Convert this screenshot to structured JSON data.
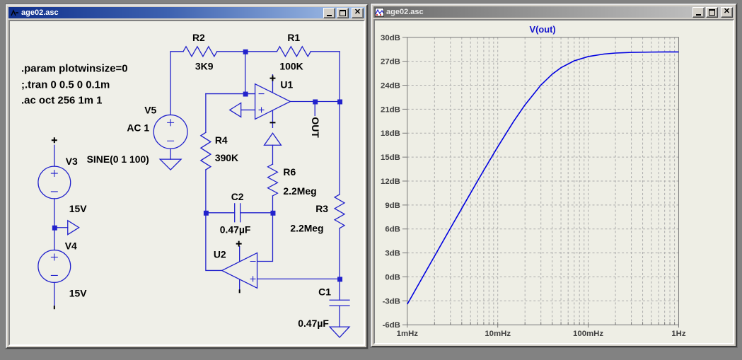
{
  "left_window": {
    "title": "age02.asc"
  },
  "right_window": {
    "title": "age02.asc"
  },
  "schematic": {
    "directives": [
      ".param plotwinsize=0",
      ";.tran 0 0.5 0 0.1m",
      ".ac oct 256 1m 1"
    ],
    "components": {
      "R1": {
        "name": "R1",
        "value": "100K"
      },
      "R2": {
        "name": "R2",
        "value": "3K9"
      },
      "R3": {
        "name": "R3",
        "value": "2.2Meg"
      },
      "R4": {
        "name": "R4",
        "value": "390K"
      },
      "R6": {
        "name": "R6",
        "value": "2.2Meg"
      },
      "C1": {
        "name": "C1",
        "value": "0.47µF"
      },
      "C2": {
        "name": "C2",
        "value": "0.47µF"
      },
      "U1": {
        "name": "U1"
      },
      "U2": {
        "name": "U2"
      },
      "V3": {
        "name": "V3",
        "value": "15V"
      },
      "V4": {
        "name": "V4",
        "value": "15V"
      },
      "V5": {
        "name": "V5",
        "value": "AC 1",
        "value2": "SINE(0 1 100)"
      }
    },
    "net_labels": {
      "out": "OUT"
    }
  },
  "chart_data": {
    "type": "line",
    "title": "V(out)",
    "x_scale": "log",
    "x_unit": "Hz",
    "y_unit": "dB",
    "x_range_hz": [
      0.001,
      1
    ],
    "y_range_db": [
      -6,
      30
    ],
    "y_step_db": 3,
    "grid": "dashed",
    "legend_position": "top-center-title",
    "x_ticks": [
      "1mHz",
      "10mHz",
      "100mHz",
      "1Hz"
    ],
    "y_ticks": [
      "30dB",
      "27dB",
      "24dB",
      "21dB",
      "18dB",
      "15dB",
      "12dB",
      "9dB",
      "6dB",
      "3dB",
      "0dB",
      "-3dB",
      "-6dB"
    ],
    "series": [
      {
        "name": "V(out)",
        "color": "#0000E0",
        "points": [
          [
            0.001,
            -3.42
          ],
          [
            0.0015,
            0.1
          ],
          [
            0.002,
            2.59
          ],
          [
            0.003,
            6.1
          ],
          [
            0.004,
            8.58
          ],
          [
            0.005,
            10.49
          ],
          [
            0.007,
            13.34
          ],
          [
            0.01,
            16.29
          ],
          [
            0.015,
            19.48
          ],
          [
            0.02,
            21.54
          ],
          [
            0.03,
            24.02
          ],
          [
            0.04,
            25.39
          ],
          [
            0.05,
            26.2
          ],
          [
            0.07,
            27.06
          ],
          [
            0.1,
            27.59
          ],
          [
            0.15,
            27.91
          ],
          [
            0.2,
            28.03
          ],
          [
            0.3,
            28.11
          ],
          [
            0.5,
            28.16
          ],
          [
            0.7,
            28.17
          ],
          [
            1.0,
            28.17
          ]
        ]
      }
    ]
  }
}
